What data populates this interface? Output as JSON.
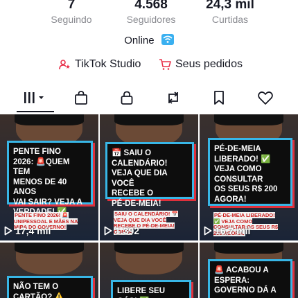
{
  "stats": [
    {
      "value": "7",
      "label": "Seguindo"
    },
    {
      "value": "4.568",
      "label": "Seguidores"
    },
    {
      "value": "24,3 mil",
      "label": "Curtidas"
    }
  ],
  "status": {
    "text": "Online",
    "icon": "wifi-icon"
  },
  "actions": [
    {
      "label": "TikTok Studio",
      "icon": "studio-icon"
    },
    {
      "label": "Seus pedidos",
      "icon": "cart-icon"
    }
  ],
  "tabs": [
    {
      "name": "videos",
      "icon": "grid-icon",
      "active": true
    },
    {
      "name": "shop",
      "icon": "bag-icon"
    },
    {
      "name": "private",
      "icon": "lock-icon"
    },
    {
      "name": "reposts",
      "icon": "repost-icon"
    },
    {
      "name": "favorites",
      "icon": "bookmark-icon"
    },
    {
      "name": "liked",
      "icon": "heart-icon"
    }
  ],
  "videos": [
    {
      "card_text": "PENTE FINO\n2026: 🚨QUEM TEM\nMENOS DE 40 ANOS\nVAI SAIR? VEJA A\nVERDADE! ✅",
      "caption": "PENTE FINO 2026! 🚨 UNIPESSOAL E MÃES NA MIRA DO GOVERNO!",
      "views": "17,4 mil"
    },
    {
      "card_text": "📅 SAIU O\nCALENDÁRIO!\nVEJA QUE DIA VOCÊ\nRECEBE O\nPÉ-DE-MEIA!",
      "caption": "SAIU O CALENDÁRIO! 📅 VEJA QUE DIA VOCÊ RECEBE O PÉ-DE-MEIA! CONTA",
      "views": "1.392"
    },
    {
      "card_text": "PÉ-DE-MEIA\nLIBERADO! ✅\nVEJA COMO\nCONSULTAR\nOS SEUS R$ 200\nAGORA!",
      "caption": "PÉ-DE-MEIA LIBERADO! ✅ VEJA COMO CONSULTAR OS SEUS R$ 200 AGORA!",
      "views": "16,7 mil"
    },
    {
      "card_text": "NÃO TEM O\nCARTÃO? ⚠️ VEJA",
      "caption": "",
      "views": ""
    },
    {
      "card_text": "LIBERE SEU GÁS! ✅",
      "caption": "",
      "views": ""
    },
    {
      "card_text": "🚨 ACABOU A\nESPERA:\nGOVERNO DÁ A",
      "caption": "",
      "views": ""
    }
  ]
}
